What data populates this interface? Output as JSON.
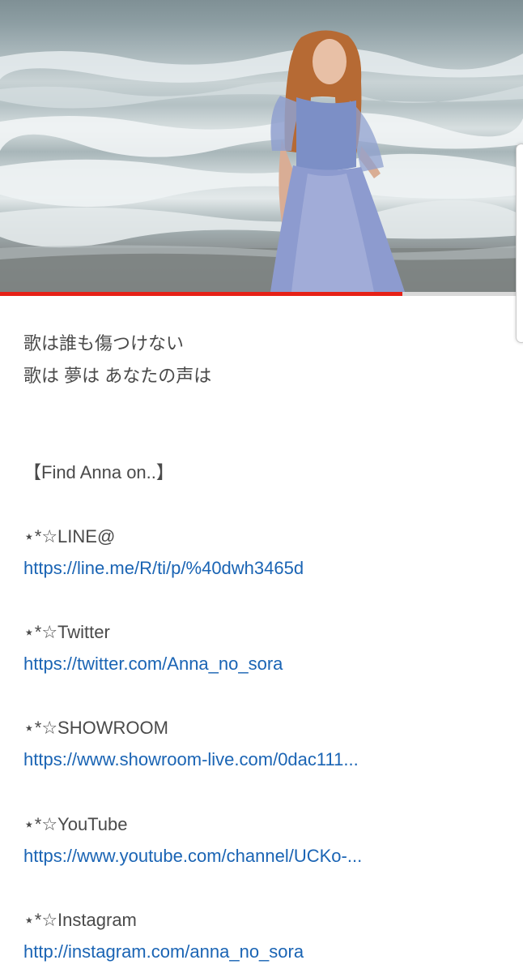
{
  "video": {
    "progress_fraction": 0.77
  },
  "description": {
    "lyric_lines": [
      "歌は誰も傷つけない",
      "歌は 夢は あなたの声は"
    ],
    "find_heading": "【Find Anna on..】",
    "links": [
      {
        "label": "⋆*☆LINE@",
        "url": "https://line.me/R/ti/p/%40dwh3465d"
      },
      {
        "label": "⋆*☆Twitter",
        "url": "https://twitter.com/Anna_no_sora"
      },
      {
        "label": "⋆*☆SHOWROOM",
        "url": "https://www.showroom-live.com/0dac111..."
      },
      {
        "label": "⋆*☆YouTube",
        "url": "https://www.youtube.com/channel/UCKo-..."
      },
      {
        "label": "⋆*☆Instagram",
        "url": "http://instagram.com/anna_no_sora"
      }
    ]
  },
  "colors": {
    "progress_fill": "#e62117",
    "link": "#1a64b4",
    "text": "#4a4a4a"
  }
}
